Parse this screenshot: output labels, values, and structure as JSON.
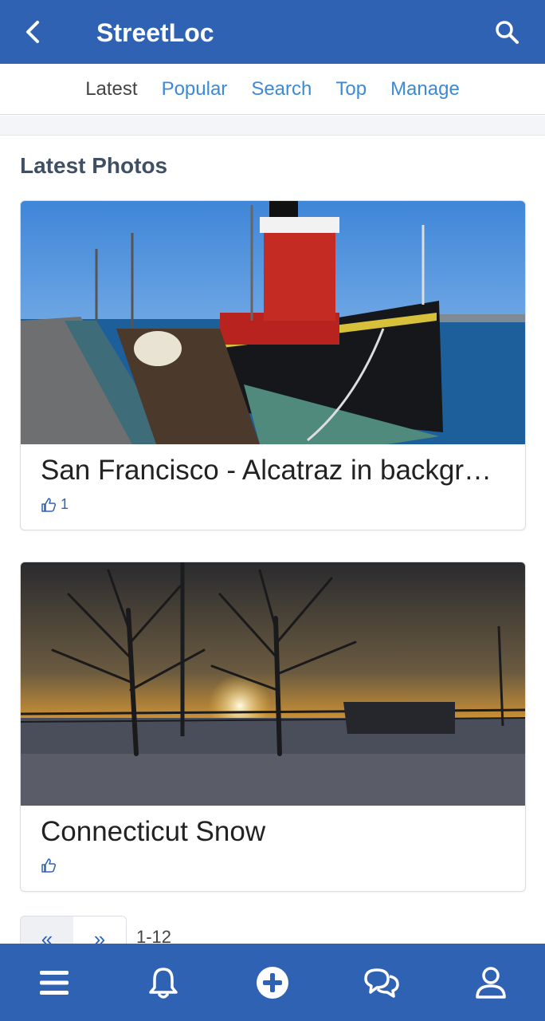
{
  "appbar": {
    "title": "StreetLoc",
    "back_icon": "chevron-left-icon",
    "search_icon": "search-icon"
  },
  "tabs": [
    {
      "label": "Latest",
      "active": true
    },
    {
      "label": "Popular",
      "active": false
    },
    {
      "label": "Search",
      "active": false
    },
    {
      "label": "Top",
      "active": false
    },
    {
      "label": "Manage",
      "active": false
    }
  ],
  "section": {
    "title": "Latest Photos"
  },
  "photos": [
    {
      "caption": "San Francisco - Alcatraz in backgr…",
      "likes": "1"
    },
    {
      "caption": "Connecticut Snow",
      "likes": ""
    }
  ],
  "pager": {
    "first_label": "«",
    "next_label": "»",
    "range": "1-12"
  },
  "bottom_nav": [
    "menu-icon",
    "bell-icon",
    "add-icon",
    "chat-icon",
    "profile-icon"
  ],
  "colors": {
    "primary": "#2f62b3",
    "link": "#3a8ad8"
  }
}
